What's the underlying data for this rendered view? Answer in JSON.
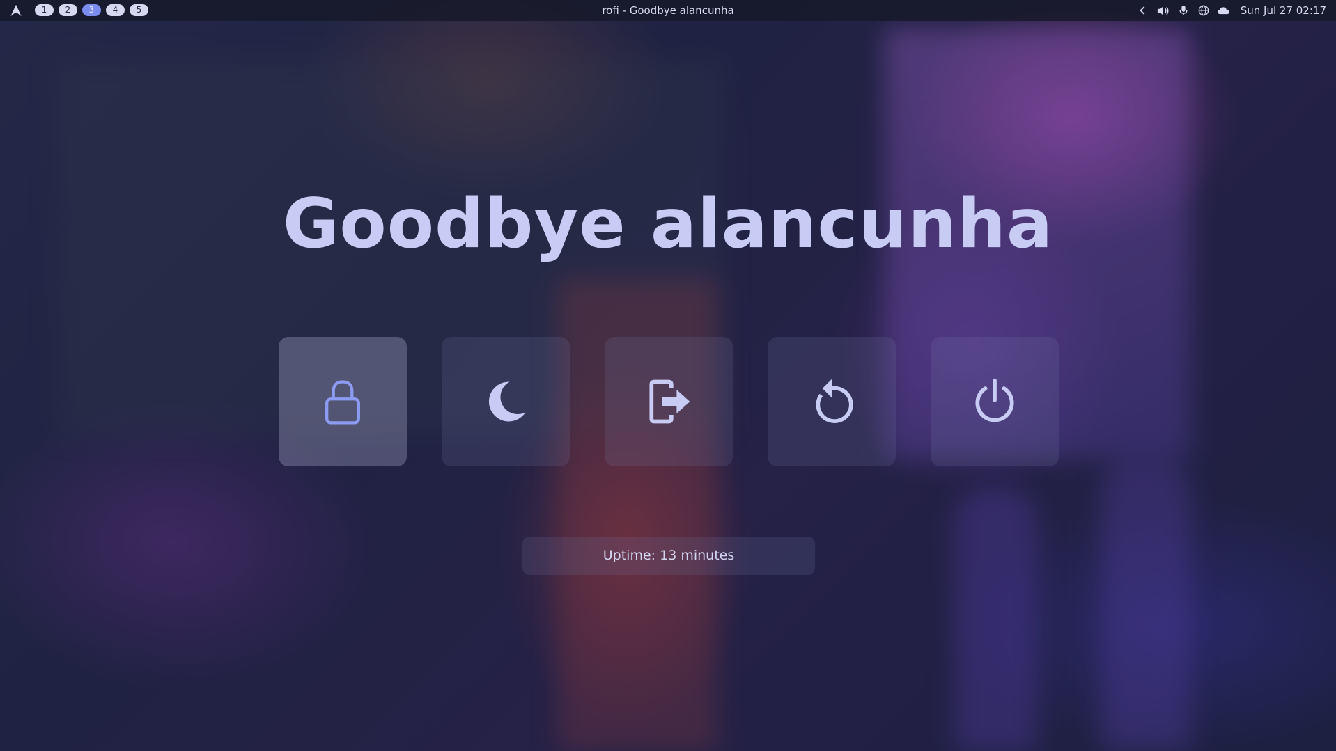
{
  "topbar": {
    "launcher_icon": "arch-logo-icon",
    "workspaces": [
      {
        "label": "1",
        "active": false
      },
      {
        "label": "2",
        "active": false
      },
      {
        "label": "3",
        "active": true
      },
      {
        "label": "4",
        "active": false
      },
      {
        "label": "5",
        "active": false
      }
    ],
    "window_title": "rofi - Goodbye alancunha",
    "tray_icons": [
      "chevron-left-icon",
      "volume-icon",
      "microphone-icon",
      "network-icon",
      "cloud-icon"
    ],
    "clock": "Sun Jul 27 02:17"
  },
  "power_menu": {
    "greeting": "Goodbye alancunha",
    "options": [
      {
        "name": "lock",
        "icon": "lock-icon",
        "selected": true
      },
      {
        "name": "suspend",
        "icon": "moon-icon",
        "selected": false
      },
      {
        "name": "logout",
        "icon": "logout-icon",
        "selected": false
      },
      {
        "name": "reboot",
        "icon": "reboot-icon",
        "selected": false
      },
      {
        "name": "shutdown",
        "icon": "power-icon",
        "selected": false
      }
    ],
    "uptime": "Uptime: 13 minutes"
  },
  "colors": {
    "accent": "#7a8cf0",
    "greeting_text": "#c8ccf4",
    "icon_color": "#c8ccf4",
    "selected_icon_color": "#8b9cf2",
    "topbar_bg": "#161828"
  }
}
